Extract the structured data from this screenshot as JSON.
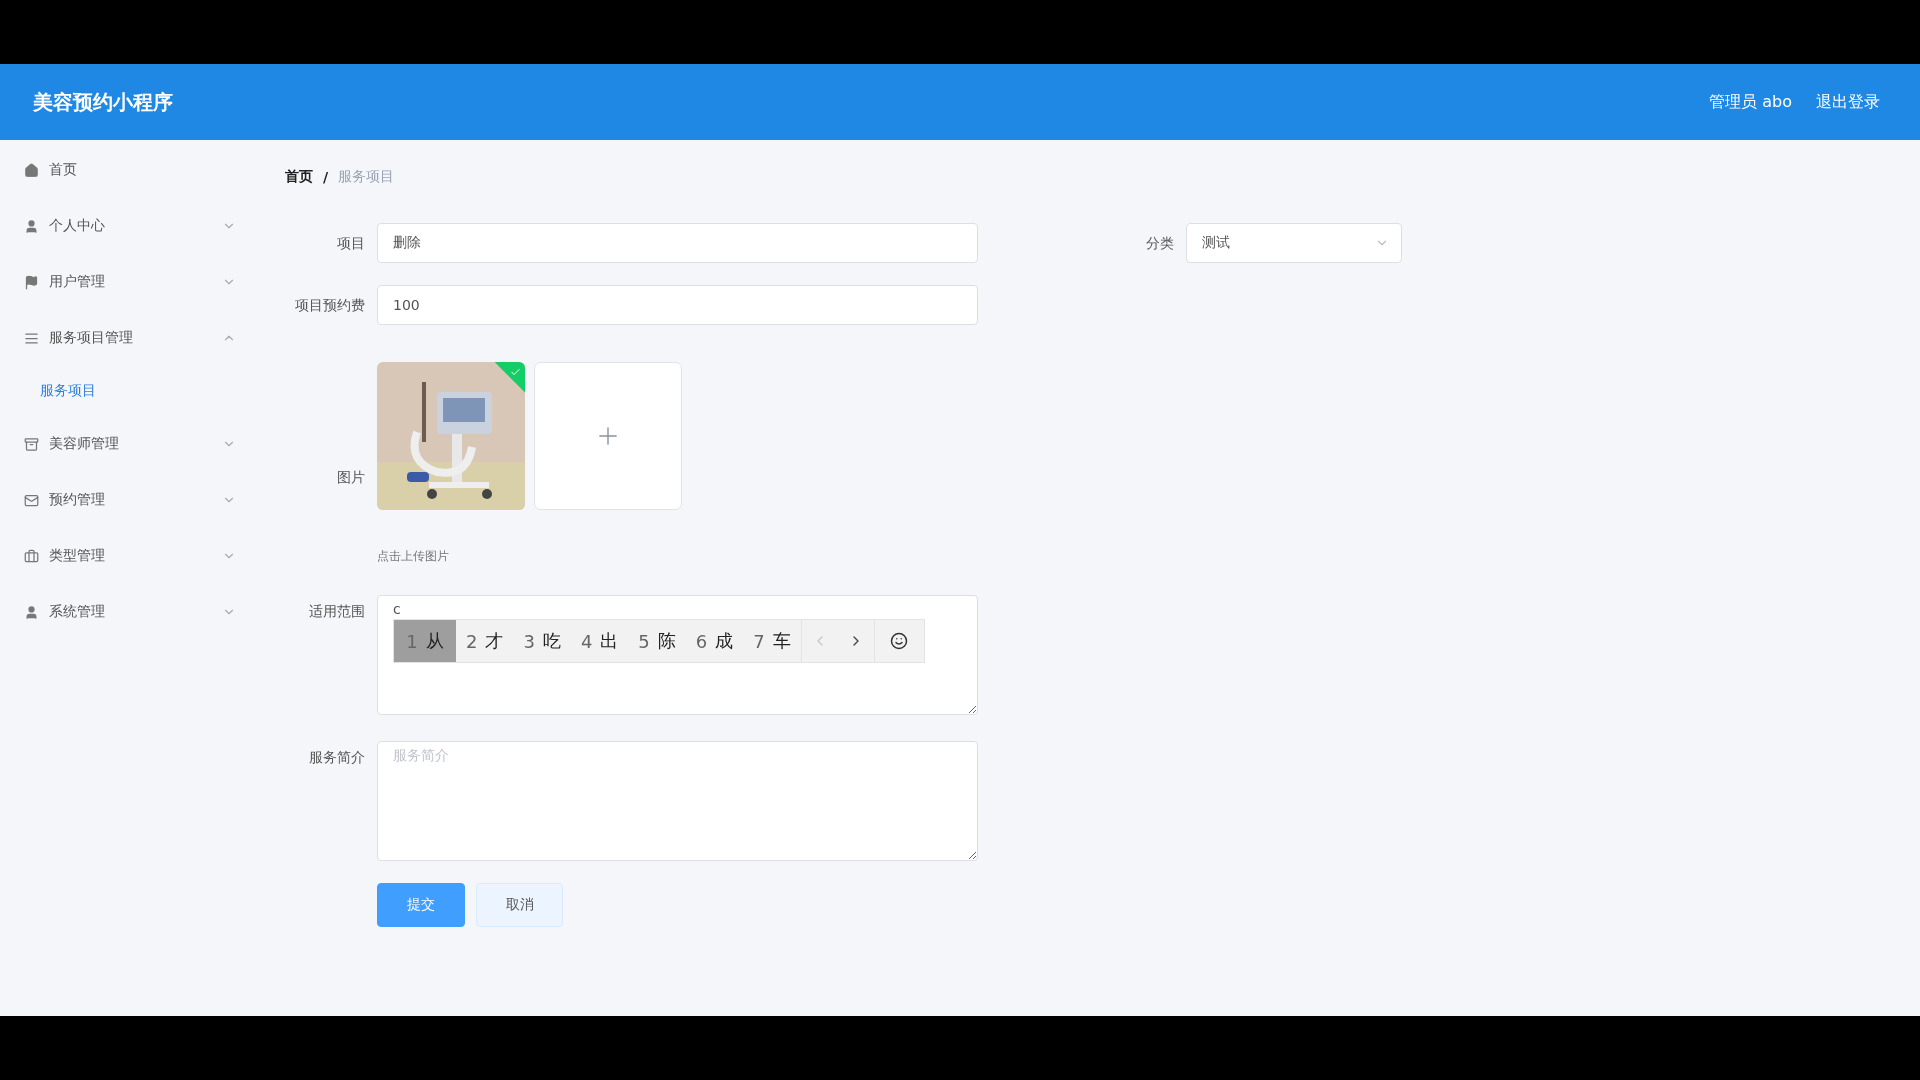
{
  "header": {
    "title": "美容预约小程序",
    "user": "管理员 abo",
    "logout": "退出登录"
  },
  "sidebar": {
    "items": [
      {
        "label": "首页",
        "kind": "link"
      },
      {
        "label": "个人中心",
        "kind": "menu",
        "expanded": false
      },
      {
        "label": "用户管理",
        "kind": "menu",
        "expanded": false
      },
      {
        "label": "服务项目管理",
        "kind": "menu",
        "expanded": true,
        "children": [
          {
            "label": "服务项目",
            "selected": true
          }
        ]
      },
      {
        "label": "美容师管理",
        "kind": "menu",
        "expanded": false
      },
      {
        "label": "预约管理",
        "kind": "menu",
        "expanded": false
      },
      {
        "label": "类型管理",
        "kind": "menu",
        "expanded": false
      },
      {
        "label": "系统管理",
        "kind": "menu",
        "expanded": false
      }
    ]
  },
  "breadcrumb": {
    "items": [
      "首页",
      "服务项目"
    ],
    "separator": "/"
  },
  "form": {
    "item": {
      "label": "项目",
      "value": "删除"
    },
    "category": {
      "label": "分类",
      "value": "测试"
    },
    "fee": {
      "label": "项目预约费",
      "value": "100"
    },
    "image": {
      "label": "图片",
      "uploaded": true,
      "hint": "点击上传图片"
    },
    "scope": {
      "label": "适用范围",
      "value": "c"
    },
    "intro": {
      "label": "服务简介",
      "placeholder": "服务简介"
    },
    "buttons": [
      {
        "label": "提交",
        "kind": "primary"
      },
      {
        "label": "取消",
        "kind": "default"
      }
    ]
  },
  "ime": {
    "candidates": [
      {
        "index": "1",
        "text": "从",
        "selected": true
      },
      {
        "index": "2",
        "text": "才",
        "selected": false
      },
      {
        "index": "3",
        "text": "吃",
        "selected": false
      },
      {
        "index": "4",
        "text": "出",
        "selected": false
      },
      {
        "index": "5",
        "text": "陈",
        "selected": false
      },
      {
        "index": "6",
        "text": "成",
        "selected": false
      },
      {
        "index": "7",
        "text": "车",
        "selected": false
      }
    ],
    "prev_disabled": true,
    "next_disabled": false
  }
}
